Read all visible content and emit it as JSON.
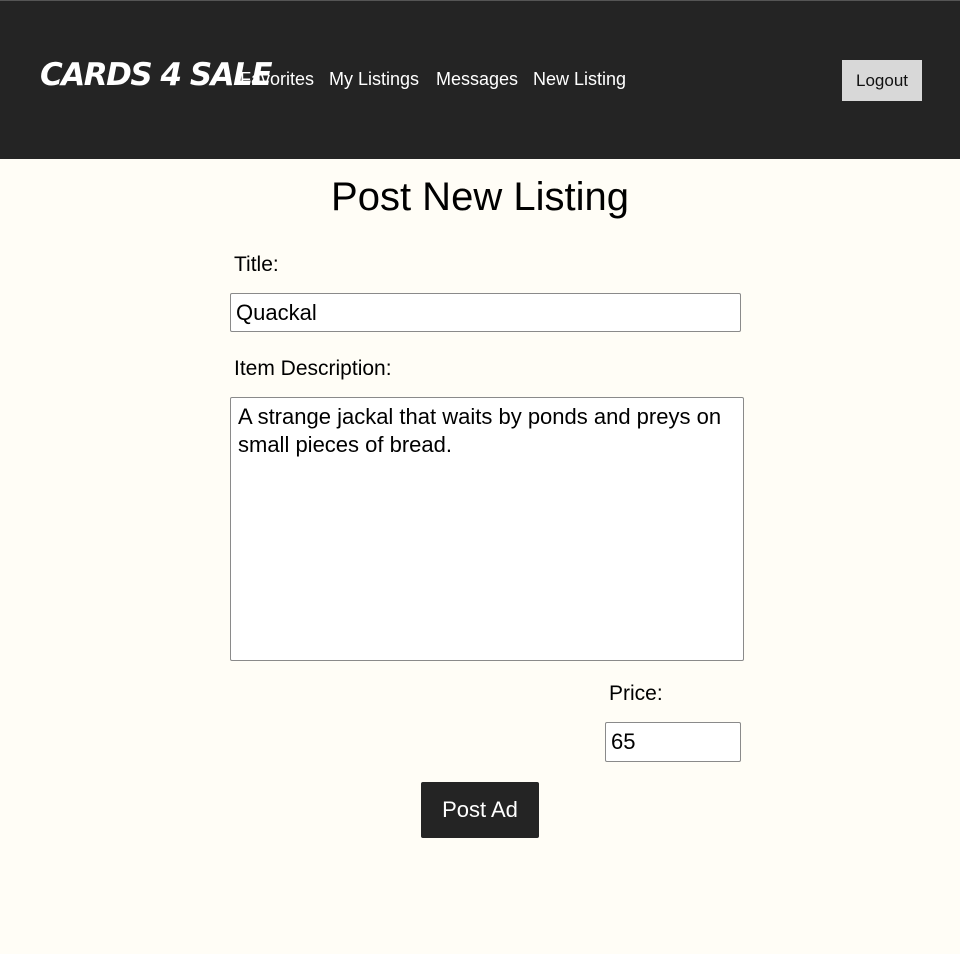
{
  "header": {
    "brand": "Cards 4 Sale",
    "nav": {
      "favorites": "Favorites",
      "my_listings": "My Listings",
      "messages": "Messages",
      "new_listing": "New Listing"
    },
    "logout_label": "Logout"
  },
  "form": {
    "page_title": "Post New Listing",
    "title_label": "Title:",
    "title_value": "Quackal",
    "description_label": "Item Description:",
    "description_value": "A strange jackal that waits by ponds and preys on small pieces of bread.",
    "price_label": "Price:",
    "price_value": "65",
    "submit_label": "Post Ad"
  },
  "colors": {
    "nav_background": "#242424",
    "page_background": "#fffdf6",
    "logout_background": "#d8d8d8",
    "button_background": "#242424"
  }
}
